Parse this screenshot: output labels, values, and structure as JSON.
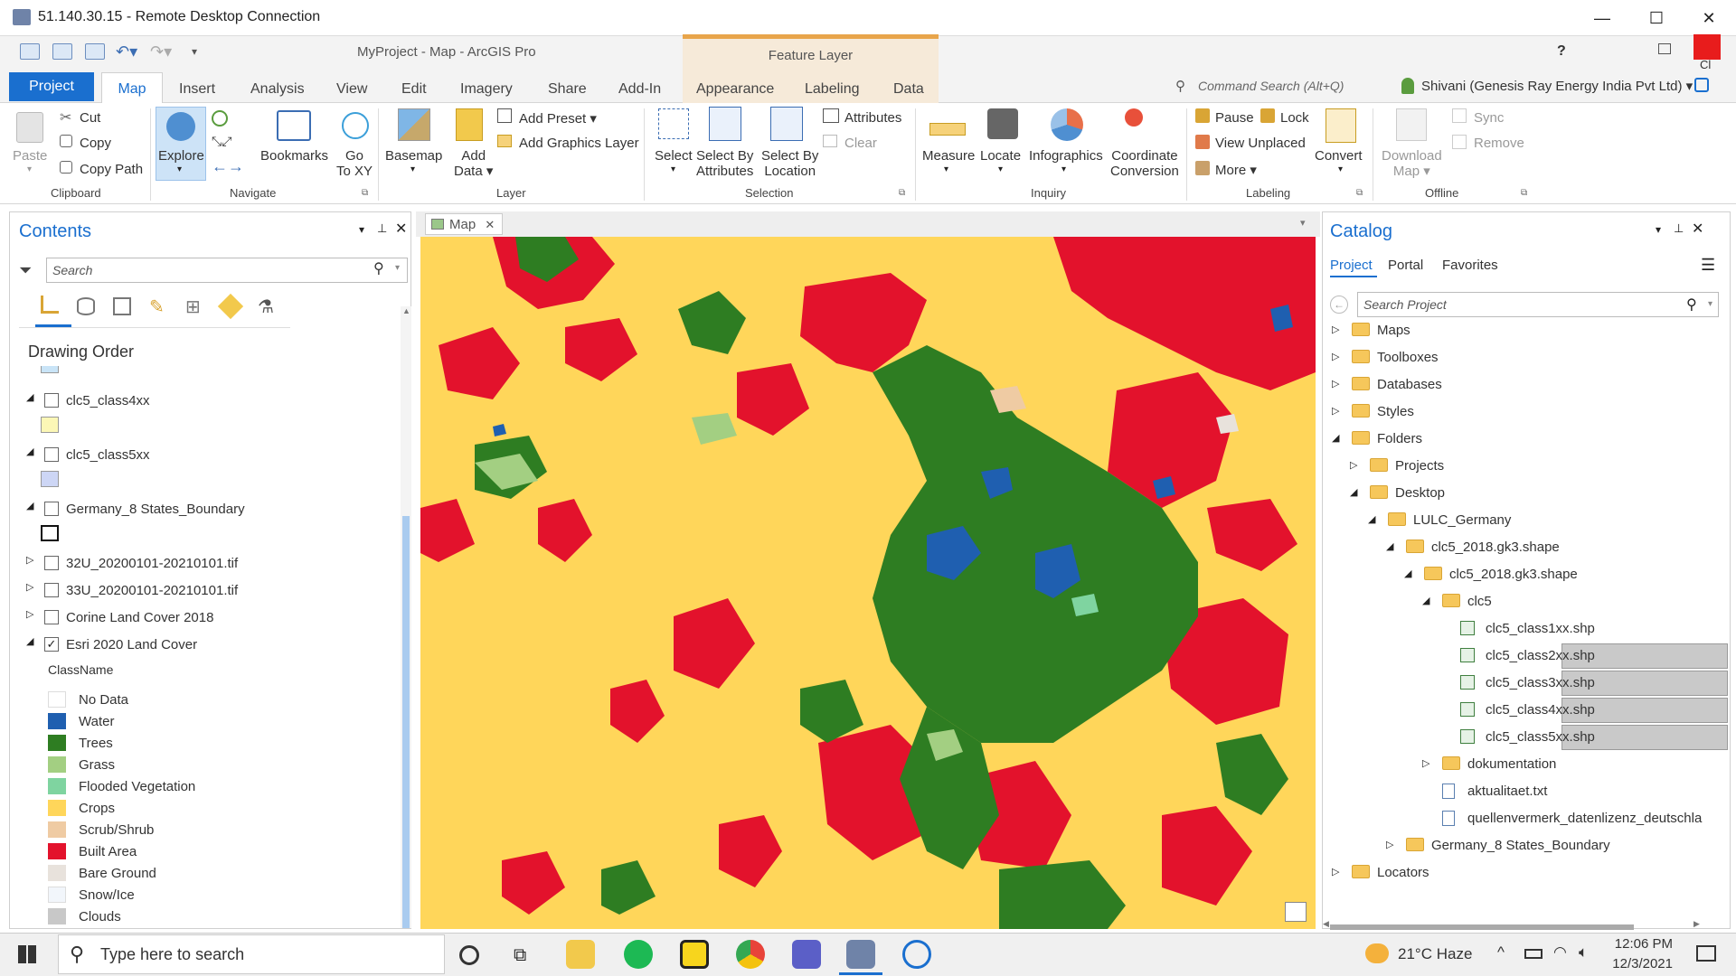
{
  "rdp": {
    "title": "51.140.30.15 - Remote Desktop Connection"
  },
  "app": {
    "title": "MyProject - Map - ArcGIS Pro",
    "context_tab": "Feature Layer",
    "help": "?"
  },
  "tabs": [
    "Project",
    "Map",
    "Insert",
    "Analysis",
    "View",
    "Edit",
    "Imagery",
    "Share",
    "Add-In",
    "Appearance",
    "Labeling",
    "Data"
  ],
  "command_search": {
    "placeholder": "Command Search (Alt+Q)"
  },
  "user": "Shivani (Genesis Ray Energy India Pvt Ltd)",
  "ribbon": {
    "clipboard": {
      "paste": "Paste",
      "cut": "Cut",
      "copy": "Copy",
      "copy_path": "Copy Path",
      "group": "Clipboard"
    },
    "navigate": {
      "explore": "Explore",
      "bookmarks": "Bookmarks",
      "goto_xy": "Go\nTo XY",
      "go": "Go",
      "to_xy": "To XY",
      "group": "Navigate"
    },
    "layer": {
      "basemap": "Basemap",
      "add": "Add",
      "data": "Data",
      "add_preset": "Add Preset",
      "add_graphics": "Add Graphics Layer",
      "group": "Layer"
    },
    "selection": {
      "select": "Select",
      "select_by": "Select By",
      "attributes": "Attributes",
      "location": "Location",
      "attr_btn": "Attributes",
      "clear": "Clear",
      "group": "Selection"
    },
    "inquiry": {
      "measure": "Measure",
      "locate": "Locate",
      "infographics": "Infographics",
      "coordinate": "Coordinate",
      "conversion": "Conversion",
      "group": "Inquiry"
    },
    "labeling": {
      "pause": "Pause",
      "lock": "Lock",
      "view_unplaced": "View Unplaced",
      "more": "More",
      "convert": "Convert",
      "group": "Labeling"
    },
    "offline": {
      "download": "Download",
      "map": "Map",
      "sync": "Sync",
      "remove": "Remove",
      "group": "Offline"
    }
  },
  "contents": {
    "title": "Contents",
    "search_placeholder": "Search",
    "drawing_order": "Drawing Order",
    "layers": [
      {
        "name": "clc5_class4xx",
        "checked": false
      },
      {
        "name": "clc5_class5xx",
        "checked": false
      },
      {
        "name": "Germany_8 States_Boundary",
        "checked": false
      },
      {
        "name": "32U_20200101-20210101.tif",
        "checked": false
      },
      {
        "name": "33U_20200101-20210101.tif",
        "checked": false
      },
      {
        "name": "Corine Land Cover 2018",
        "checked": false
      },
      {
        "name": "Esri 2020 Land Cover",
        "checked": true
      }
    ],
    "classname_header": "ClassName",
    "legend": [
      {
        "label": "No Data",
        "color": "#ffffff"
      },
      {
        "label": "Water",
        "color": "#1f5fb0"
      },
      {
        "label": "Trees",
        "color": "#2e7d22"
      },
      {
        "label": "Grass",
        "color": "#a3cf82"
      },
      {
        "label": "Flooded Vegetation",
        "color": "#7fd4a0"
      },
      {
        "label": "Crops",
        "color": "#ffd65a"
      },
      {
        "label": "Scrub/Shrub",
        "color": "#efcba3"
      },
      {
        "label": "Built Area",
        "color": "#e3122c"
      },
      {
        "label": "Bare Ground",
        "color": "#e8e2dc"
      },
      {
        "label": "Snow/Ice",
        "color": "#f2f6fb"
      },
      {
        "label": "Clouds",
        "color": "#c8c8c8"
      }
    ]
  },
  "map": {
    "tab": "Map"
  },
  "catalog": {
    "title": "Catalog",
    "tabs": [
      "Project",
      "Portal",
      "Favorites"
    ],
    "search_placeholder": "Search Project",
    "tree": [
      {
        "label": "Maps"
      },
      {
        "label": "Toolboxes"
      },
      {
        "label": "Databases"
      },
      {
        "label": "Styles"
      },
      {
        "label": "Folders"
      },
      {
        "label": "Projects"
      },
      {
        "label": "Desktop"
      },
      {
        "label": "LULC_Germany"
      },
      {
        "label": "clc5_2018.gk3.shape"
      },
      {
        "label": "clc5_2018.gk3.shape"
      },
      {
        "label": "clc5"
      },
      {
        "label": "clc5_class1xx.shp"
      },
      {
        "label": "clc5_class2xx.shp"
      },
      {
        "label": "clc5_class3xx.shp"
      },
      {
        "label": "clc5_class4xx.shp"
      },
      {
        "label": "clc5_class5xx.shp"
      },
      {
        "label": "dokumentation"
      },
      {
        "label": "aktualitaet.txt"
      },
      {
        "label": "quellenvermerk_datenlizenz_deutschla"
      },
      {
        "label": "Germany_8 States_Boundary"
      },
      {
        "label": "Locators"
      }
    ]
  },
  "taskbar": {
    "search_placeholder": "Type here to search",
    "weather": "21°C  Haze",
    "time": "12:06 PM",
    "date": "12/3/2021"
  },
  "colors": {
    "accent": "#1a6fcf",
    "built": "#e3122c",
    "trees": "#2e7d22",
    "water": "#1f5fb0",
    "crops": "#ffd65a"
  }
}
